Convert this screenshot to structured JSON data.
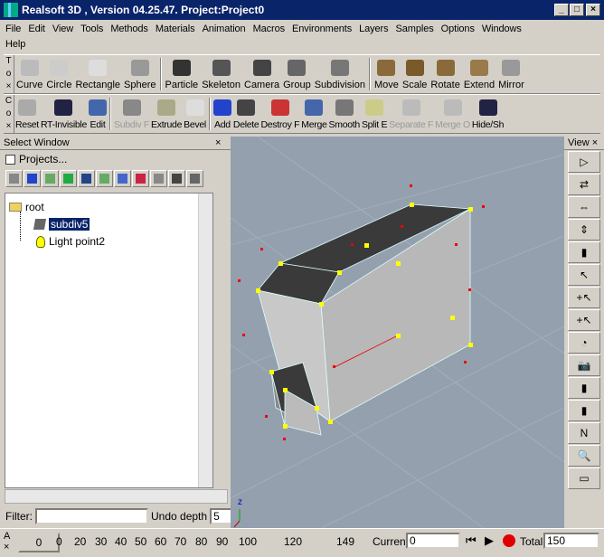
{
  "window": {
    "title": "Realsoft 3D , Version 04.25.47. Project:Project0",
    "minimize": "_",
    "maximize": "□",
    "close": "×"
  },
  "menu": [
    "File",
    "Edit",
    "View",
    "Tools",
    "Methods",
    "Materials",
    "Animation",
    "Macros",
    "Environments",
    "Layers",
    "Samples",
    "Options",
    "Windows",
    "Help"
  ],
  "toolbar1": {
    "grip": [
      "T",
      "o",
      "×"
    ],
    "tools": [
      "Curve",
      "Circle",
      "Rectangle",
      "Sphere",
      "Particle",
      "Skeleton",
      "Camera",
      "Group",
      "Subdivision",
      "Move",
      "Scale",
      "Rotate",
      "Extend",
      "Mirror"
    ]
  },
  "toolbar2": {
    "grip": [
      "C",
      "o",
      "×"
    ],
    "tools": [
      "Reset",
      "RT-Invisible",
      "Edit",
      "Subdiv F",
      "Extrude",
      "Bevel",
      "Add",
      "Delete",
      "Destroy F",
      "Merge",
      "Smooth",
      "Split E",
      "Separate F",
      "Merge O",
      "Hide/Sh"
    ]
  },
  "select_window": {
    "title": "Select Window",
    "close": "×",
    "projects_label": "Projects...",
    "tree": [
      {
        "label": "root"
      },
      {
        "label": "subdiv5",
        "selected": true
      },
      {
        "label": "Light point2"
      }
    ],
    "filter_label": "Filter:",
    "filter_value": "",
    "undo_label": "Undo depth",
    "undo_value": "5"
  },
  "view_panel": {
    "title": "View",
    "close": "×"
  },
  "timeline": {
    "grip": [
      "A",
      "×"
    ],
    "frame": "0",
    "ticks": [
      "0",
      "20",
      "30",
      "40",
      "50",
      "60",
      "70",
      "80",
      "90",
      "100",
      "120",
      "149"
    ],
    "current_label": "Current",
    "current_value": "0",
    "total_label": "Total",
    "total_value": "150"
  },
  "colors": {
    "title_bar": "#0a246a",
    "viewport": "#94a0ae",
    "selection": "#0a246a",
    "record": "#e00000"
  }
}
